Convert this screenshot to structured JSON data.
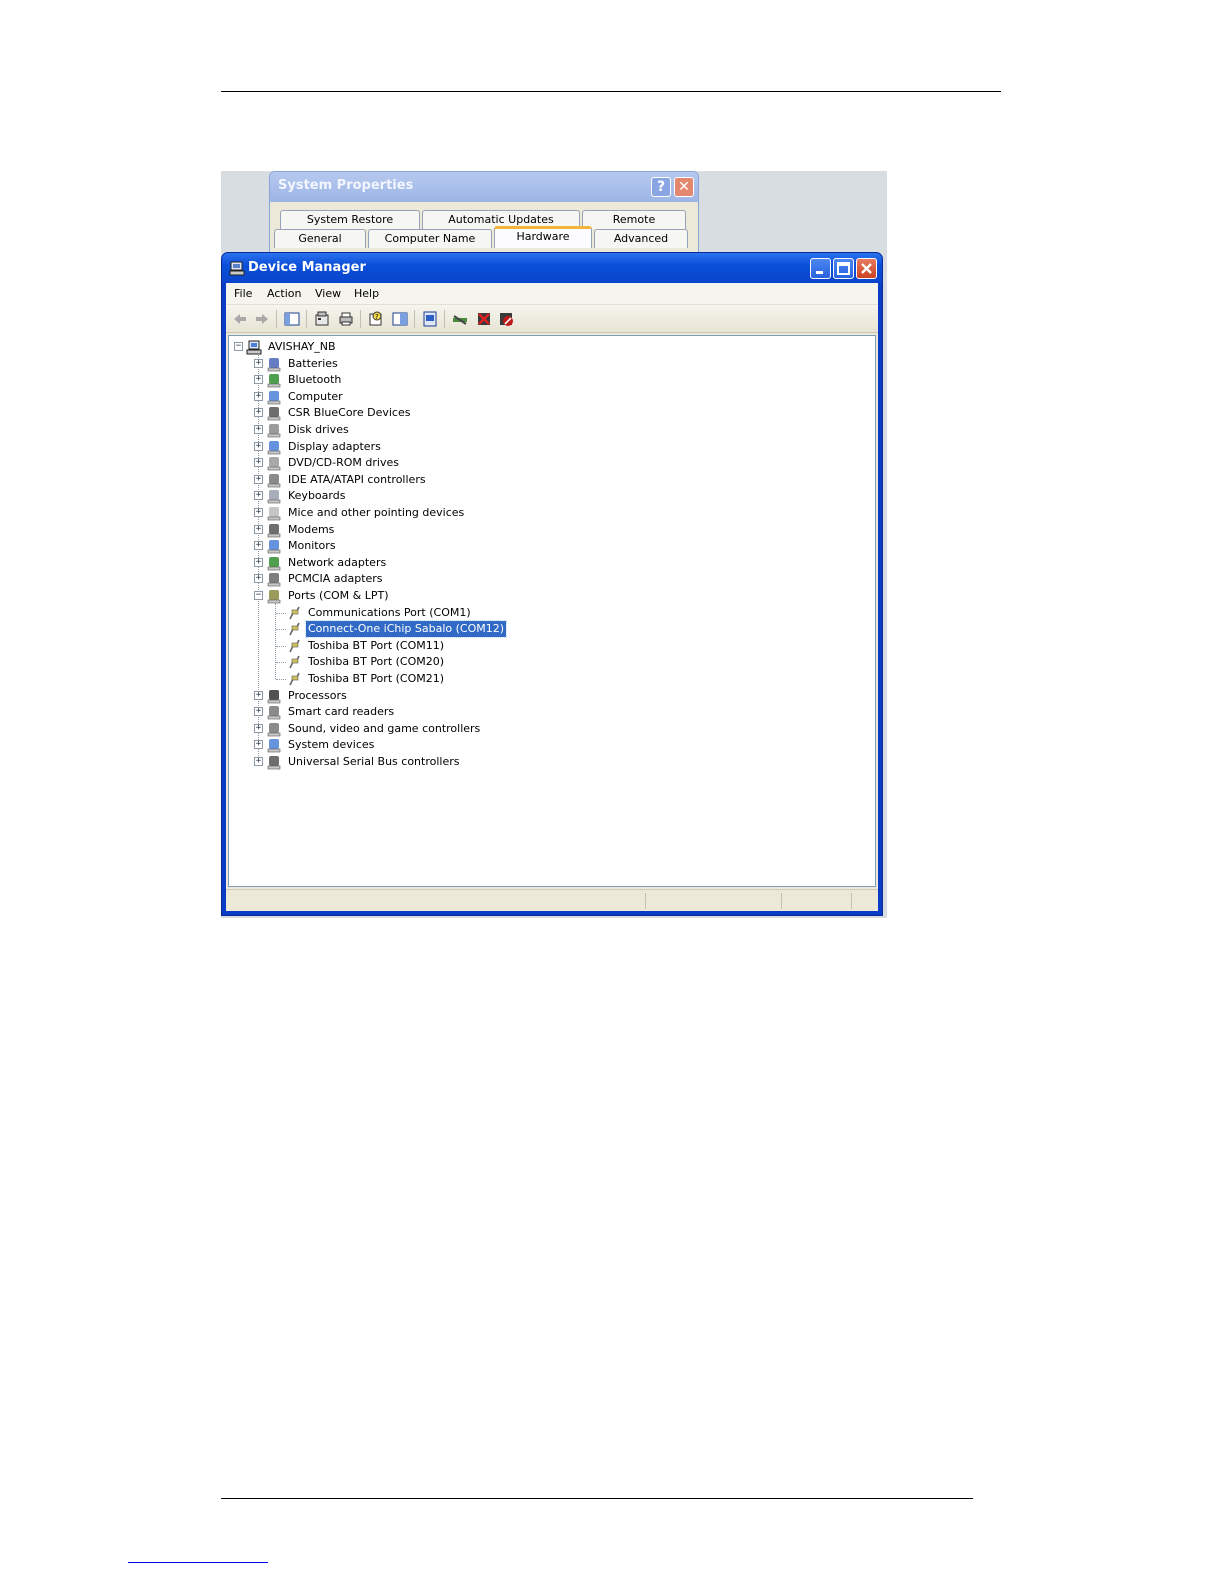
{
  "system_properties": {
    "title": "System Properties",
    "help_label": "?",
    "close_label": "✕",
    "tabs_row1": [
      "System Restore",
      "Automatic Updates",
      "Remote"
    ],
    "tabs_row2": [
      "General",
      "Computer Name",
      "Hardware",
      "Advanced"
    ],
    "active_tab": "Hardware"
  },
  "device_manager": {
    "title": "Device Manager",
    "menu": [
      "File",
      "Action",
      "View",
      "Help"
    ],
    "root": "AVISHAY_NB",
    "categories": [
      {
        "label": "Batteries",
        "icon": "battery-icon"
      },
      {
        "label": "Bluetooth",
        "icon": "bluetooth-icon"
      },
      {
        "label": "Computer",
        "icon": "computer-icon"
      },
      {
        "label": "CSR BlueCore Devices",
        "icon": "usb-icon"
      },
      {
        "label": "Disk drives",
        "icon": "disk-icon"
      },
      {
        "label": "Display adapters",
        "icon": "display-icon"
      },
      {
        "label": "DVD/CD-ROM drives",
        "icon": "cdrom-icon"
      },
      {
        "label": "IDE ATA/ATAPI controllers",
        "icon": "ide-icon"
      },
      {
        "label": "Keyboards",
        "icon": "keyboard-icon"
      },
      {
        "label": "Mice and other pointing devices",
        "icon": "mouse-icon"
      },
      {
        "label": "Modems",
        "icon": "modem-icon"
      },
      {
        "label": "Monitors",
        "icon": "monitor-icon"
      },
      {
        "label": "Network adapters",
        "icon": "network-icon"
      },
      {
        "label": "PCMCIA adapters",
        "icon": "pcmcia-icon"
      },
      {
        "label": "Ports (COM & LPT)",
        "icon": "port-icon",
        "expanded": true,
        "children": [
          "Communications Port (COM1)",
          "Connect-One iChip Sabalo (COM12)",
          "Toshiba BT Port (COM11)",
          "Toshiba BT Port (COM20)",
          "Toshiba BT Port (COM21)"
        ]
      },
      {
        "label": "Processors",
        "icon": "processor-icon"
      },
      {
        "label": "Smart card readers",
        "icon": "smartcard-icon"
      },
      {
        "label": "Sound, video and game controllers",
        "icon": "sound-icon"
      },
      {
        "label": "System devices",
        "icon": "system-icon"
      },
      {
        "label": "Universal Serial Bus controllers",
        "icon": "usb-icon"
      }
    ],
    "selected_child": "Connect-One iChip Sabalo (COM12)",
    "toolbar_icons": [
      "back-icon",
      "forward-icon",
      "show-hide-tree-icon",
      "properties-icon",
      "print-icon",
      "help-icon",
      "view-icon",
      "update-driver-icon",
      "scan-hardware-icon",
      "uninstall-icon",
      "disable-icon"
    ]
  },
  "colors": {
    "xp_title_blue": "#0b4fd8",
    "selection_blue": "#316ac5",
    "window_face": "#ece9d8"
  }
}
